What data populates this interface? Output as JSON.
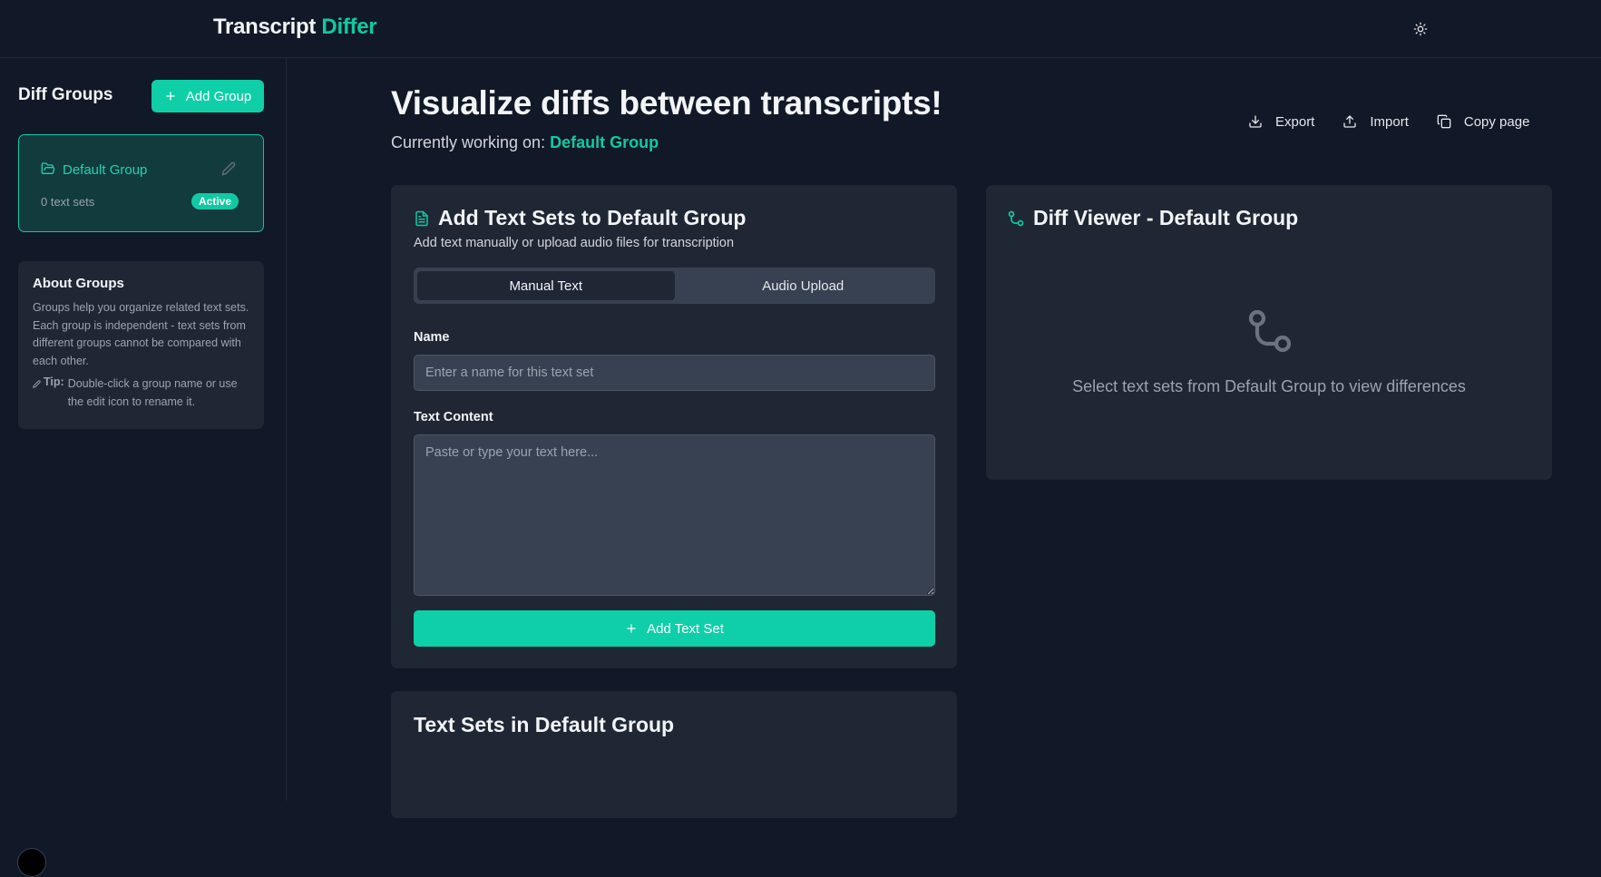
{
  "header": {
    "brand_part1": "Transcript",
    "brand_part2": "Differ",
    "theme_toggle_icon": "sun-icon"
  },
  "sidebar": {
    "title": "Diff Groups",
    "add_group_label": "Add Group",
    "groups": [
      {
        "name": "Default Group",
        "count_text": "0 text sets",
        "badge": "Active"
      }
    ],
    "about": {
      "title": "About Groups",
      "body": "Groups help you organize related text sets. Each group is independent - text sets from different groups cannot be compared with each other.",
      "tip_label": "Tip:",
      "tip_text": "Double-click a group name or use the edit icon to rename it."
    }
  },
  "main": {
    "title": "Visualize diffs between transcripts!",
    "working_on_label": "Currently working on:",
    "working_on_group": "Default Group",
    "actions": [
      {
        "label": "Export",
        "icon": "download-icon"
      },
      {
        "label": "Import",
        "icon": "upload-icon"
      },
      {
        "label": "Copy page",
        "icon": "copy-icon"
      }
    ],
    "add_card": {
      "title": "Add Text Sets to Default Group",
      "description": "Add text manually or upload audio files for transcription",
      "tabs": [
        "Manual Text",
        "Audio Upload"
      ],
      "active_tab": "Manual Text",
      "name_label": "Name",
      "name_placeholder": "Enter a name for this text set",
      "content_label": "Text Content",
      "content_placeholder": "Paste or type your text here...",
      "submit_label": "Add Text Set"
    },
    "diff_card": {
      "title": "Diff Viewer - Default Group",
      "empty_text": "Select text sets from Default Group to view differences"
    },
    "sets_card": {
      "title": "Text Sets in Default Group"
    }
  },
  "colors": {
    "accent": "#10c9a2",
    "background": "#111827",
    "card": "#1f2735"
  }
}
